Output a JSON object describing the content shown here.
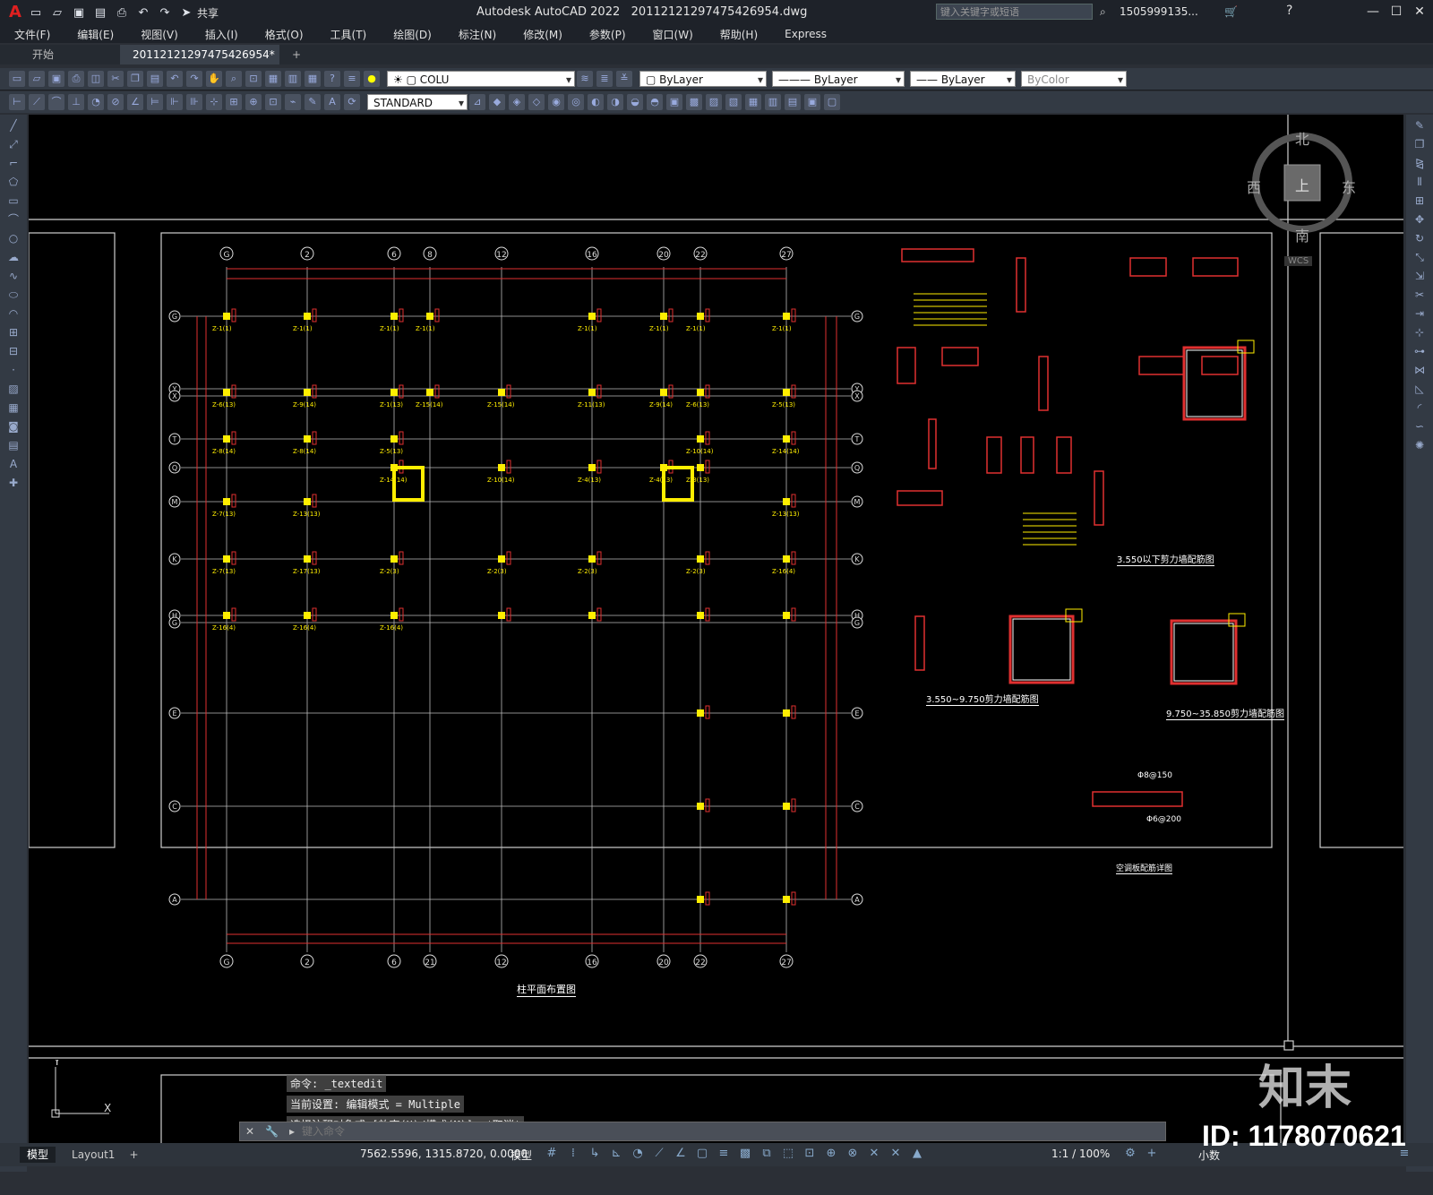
{
  "titlebar": {
    "app": "Autodesk AutoCAD 2022",
    "file": "20112121297475426954.dwg",
    "share": "共享",
    "search_placeholder": "键入关键字或短语",
    "user": "1505999135...",
    "help": "?"
  },
  "menu": [
    "文件(F)",
    "编辑(E)",
    "视图(V)",
    "插入(I)",
    "格式(O)",
    "工具(T)",
    "绘图(D)",
    "标注(N)",
    "修改(M)",
    "参数(P)",
    "窗口(W)",
    "帮助(H)",
    "Express"
  ],
  "tabs": {
    "start": "开始",
    "drawing": "20112121297475426954*",
    "add": "+"
  },
  "toolbar": {
    "layer": "COLU",
    "color": "ByLayer",
    "linetype": "ByLayer",
    "lineweight": "ByLayer",
    "plotstyle": "ByColor",
    "textstyle": "STANDARD"
  },
  "viewcube": {
    "north": "北",
    "south": "南",
    "east": "东",
    "west": "西",
    "top": "上",
    "wcs": "WCS"
  },
  "drawing": {
    "title": "柱平面布置图",
    "top_axes": [
      "G",
      "2",
      "6",
      "8",
      "12",
      "16",
      "20",
      "22",
      "27"
    ],
    "bottom_axes": [
      "G",
      "2",
      "6",
      "21",
      "12",
      "16",
      "20",
      "22",
      "27"
    ],
    "row_axes": [
      "G",
      "Y",
      "X",
      "T",
      "Q",
      "M",
      "K",
      "H",
      "G",
      "E",
      "C",
      "A"
    ],
    "detail_titles": [
      "3.550以下剪力墙配筋图",
      "3.550~9.750剪力墙配筋图",
      "9.750~35.850剪力墙配筋图",
      "空调板配筋详图"
    ],
    "detail_labels": [
      "Φ8@150",
      "Φ6@200"
    ],
    "col_labels": [
      "Z-1(1)",
      "Z-1(1)",
      "Z-1(1)",
      "Z-1(1)",
      "Z-1(1)",
      "Z-1(1)",
      "Z-1(1)",
      "Z-1(1)",
      "Z-6(13)",
      "Z-9(14)",
      "Z-1(13)",
      "Z-15(14)",
      "Z-15(14)",
      "Z-11(13)",
      "Z-9(14)",
      "Z-6(13)",
      "Z-5(13)",
      "Z-8(14)",
      "Z-8(14)",
      "Z-5(13)",
      "Z-10(14)",
      "Z-14(14)",
      "Z-14(14)",
      "Z-10(14)",
      "Z-4(13)",
      "Z-4(13)",
      "Z-3(13)",
      "Z-7(13)",
      "Z-13(13)",
      "Z-13(13)",
      "Z-7(13)",
      "Z-17(13)",
      "Z-2(3)",
      "Z-2(3)",
      "Z-2(3)",
      "Z-2(3)",
      "Z-16(4)",
      "Z-16(4)",
      "Z-16(4)",
      "Z-16(4)"
    ]
  },
  "command": {
    "history": [
      "命令: _textedit",
      "当前设置: 编辑模式 = Multiple",
      "选择注释对象或 [放弃(U)/模式(M)]: *取消*"
    ],
    "placeholder": "键入命令"
  },
  "status": {
    "model_tab": "模型",
    "layout_tab": "Layout1",
    "coords": "7562.5596, 1315.8720, 0.0000",
    "mode": "模型",
    "scale": "1:1 / 100%",
    "units": "小数"
  },
  "watermark": {
    "logo": "知末",
    "id": "ID: 1178070621"
  }
}
